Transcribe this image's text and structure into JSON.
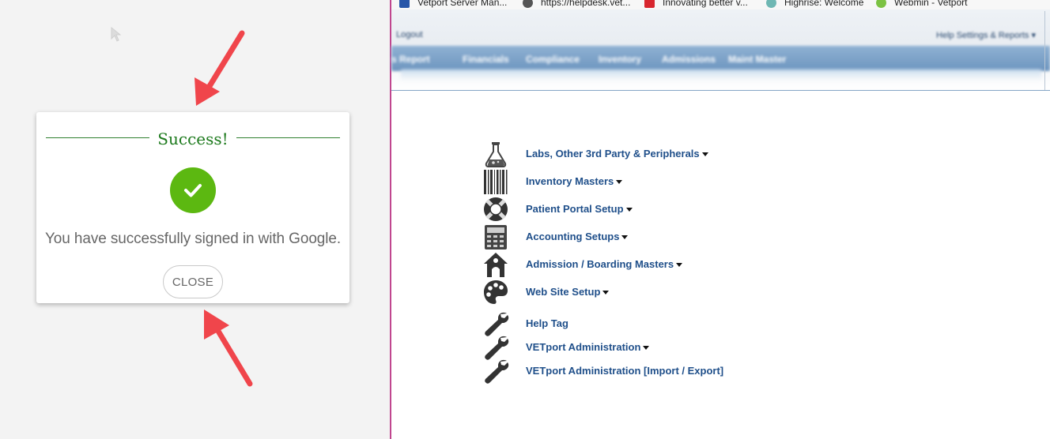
{
  "dialog": {
    "title": "Success!",
    "message": "You have successfully signed in with Google.",
    "close_label": "CLOSE",
    "accent_color": "#1d7a1d",
    "check_color": "#5cb811"
  },
  "browser": {
    "bookmarks": [
      {
        "label": "Vetport Server Man...",
        "icon": "vetport-icon"
      },
      {
        "label": "https://helpdesk.vet...",
        "icon": "globe-icon"
      },
      {
        "label": "Innovating better v...",
        "icon": "brand-icon"
      },
      {
        "label": "Highrise: Welcome",
        "icon": "highrise-icon"
      },
      {
        "label": "Webmin - Vetport",
        "icon": "webmin-icon"
      }
    ]
  },
  "app": {
    "header_left": "Logout",
    "header_right": "Help   Settings & Reports ▾",
    "nav_items": [
      "s Report",
      "Financials",
      "Compliance",
      "Inventory",
      "Admissions",
      "Maint Master"
    ],
    "menu": [
      {
        "label": "Labs, Other 3rd Party & Peripherals",
        "icon": "flask-icon",
        "dropdown": true
      },
      {
        "label": "Inventory Masters",
        "icon": "barcode-icon",
        "dropdown": true
      },
      {
        "label": "Patient Portal Setup",
        "icon": "lifebuoy-icon",
        "dropdown": true
      },
      {
        "label": "Accounting Setups",
        "icon": "calculator-icon",
        "dropdown": true
      },
      {
        "label": "Admission / Boarding Masters",
        "icon": "doghouse-icon",
        "dropdown": true
      },
      {
        "label": "Web Site Setup",
        "icon": "palette-icon",
        "dropdown": true
      },
      {
        "label": "Help Tag",
        "icon": "wrench-icon",
        "dropdown": false
      },
      {
        "label": "VETport Administration",
        "icon": "wrench-icon",
        "dropdown": true
      },
      {
        "label": "VETport Administration [Import / Export]",
        "icon": "wrench-icon",
        "dropdown": false
      }
    ]
  }
}
